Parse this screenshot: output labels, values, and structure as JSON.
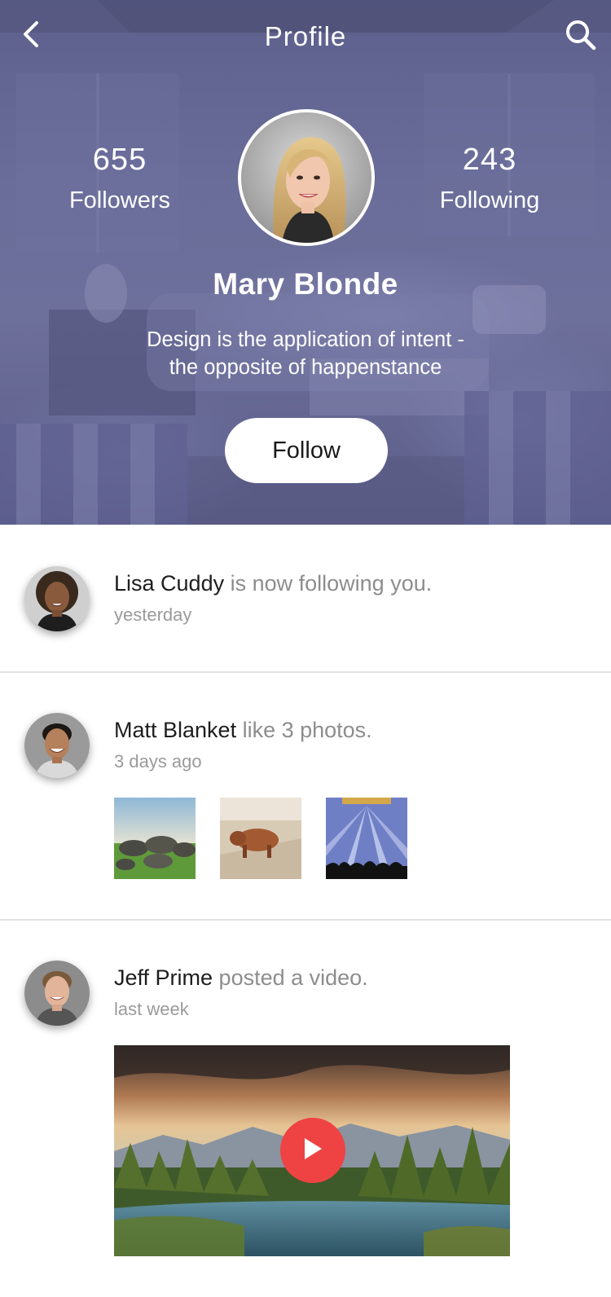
{
  "app": {
    "title": "Profile",
    "back_icon": "chevron-left-icon",
    "search_icon": "search-icon"
  },
  "profile": {
    "followers_count": "655",
    "followers_label": "Followers",
    "following_count": "243",
    "following_label": "Following",
    "name": "Mary Blonde",
    "bio_line1": "Design is the application of intent -",
    "bio_line2": "the opposite of happenstance",
    "follow_label": "Follow",
    "header_tint": "#62648f"
  },
  "feed": [
    {
      "user": "Lisa Cuddy",
      "action": " is now following you.",
      "time": "yesterday"
    },
    {
      "user": "Matt Blanket",
      "action": " like 3 photos.",
      "time": "3 days ago",
      "photos": [
        "rocks-on-grass-photo",
        "highland-cow-photo",
        "concert-lights-photo"
      ]
    },
    {
      "user": "Jeff Prime",
      "action": " posted a video.",
      "time": "last week",
      "video": "forest-lake-sunset-video"
    }
  ],
  "colors": {
    "accent_play": "#ef4343",
    "name_text": "#1e1e1e",
    "secondary_text": "#8d8d8d",
    "divider": "#e2e2e2"
  }
}
